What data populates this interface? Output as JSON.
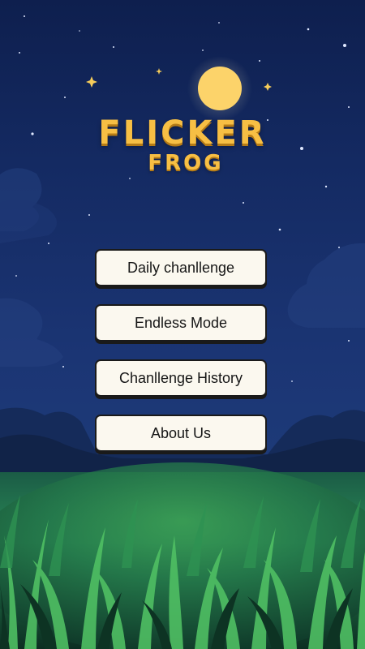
{
  "game": {
    "title_line1": "FLICKER",
    "title_line2": "FROG"
  },
  "menu": {
    "buttons": [
      {
        "label": "Daily chanllenge"
      },
      {
        "label": "Endless Mode"
      },
      {
        "label": "Chanllenge History"
      },
      {
        "label": "About Us"
      }
    ]
  },
  "colors": {
    "sky_top": "#0e1f4e",
    "sky_mid": "#1b3574",
    "moon": "#fcd36a",
    "title": "#f7bf44",
    "grass_dark": "#0f3a2a",
    "grass_light": "#3fa556",
    "button_bg": "#fbf8ef",
    "button_border": "#1a1a1a"
  }
}
